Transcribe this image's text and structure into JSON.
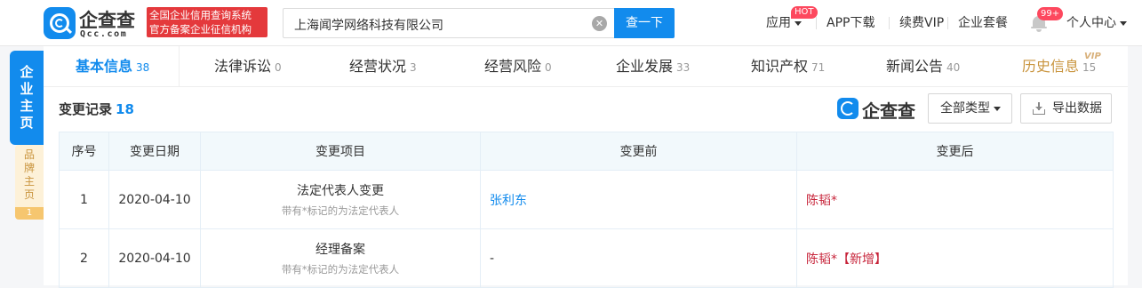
{
  "header": {
    "logo_cn": "企查查",
    "logo_en": "Qcc.com",
    "slogan_line1": "全国企业信用查询系统",
    "slogan_line2": "官方备案企业征信机构",
    "search_value": "上海闻学网络科技有限公司",
    "search_button": "查一下",
    "nav": {
      "apps": "应用",
      "apps_badge": "HOT",
      "app_download": "APP下载",
      "vip": "续费VIP",
      "enterprise": "企业套餐",
      "notify_badge": "99+",
      "user_center": "个人中心"
    }
  },
  "side_tabs": {
    "main": [
      "企",
      "业",
      "主",
      "页"
    ],
    "brand": [
      "品",
      "牌",
      "主",
      "页"
    ],
    "brand_count": "1"
  },
  "tabs": [
    {
      "label": "基本信息",
      "count": "38"
    },
    {
      "label": "法律诉讼",
      "count": "0"
    },
    {
      "label": "经营状况",
      "count": "3"
    },
    {
      "label": "经营风险",
      "count": "0"
    },
    {
      "label": "企业发展",
      "count": "33"
    },
    {
      "label": "知识产权",
      "count": "71"
    },
    {
      "label": "新闻公告",
      "count": "40"
    },
    {
      "label": "历史信息",
      "count": "15",
      "badge": "VIP"
    }
  ],
  "section": {
    "title": "变更记录",
    "count": "18",
    "watermark": "企查查",
    "type_filter": "全部类型",
    "export": "导出数据"
  },
  "table": {
    "columns": [
      "序号",
      "变更日期",
      "变更项目",
      "变更前",
      "变更后"
    ],
    "rows": [
      {
        "index": "1",
        "date": "2020-04-10",
        "item": "法定代表人变更",
        "note": "带有*标记的为法定代表人",
        "before": "张利东",
        "after": "陈韬*"
      },
      {
        "index": "2",
        "date": "2020-04-10",
        "item": "经理备案",
        "note": "带有*标记的为法定代表人",
        "before": "-",
        "after": "陈韬*【新增】"
      }
    ]
  },
  "colors": {
    "accent": "#128bed",
    "red": "#c7243a",
    "gold": "#c9943d"
  }
}
